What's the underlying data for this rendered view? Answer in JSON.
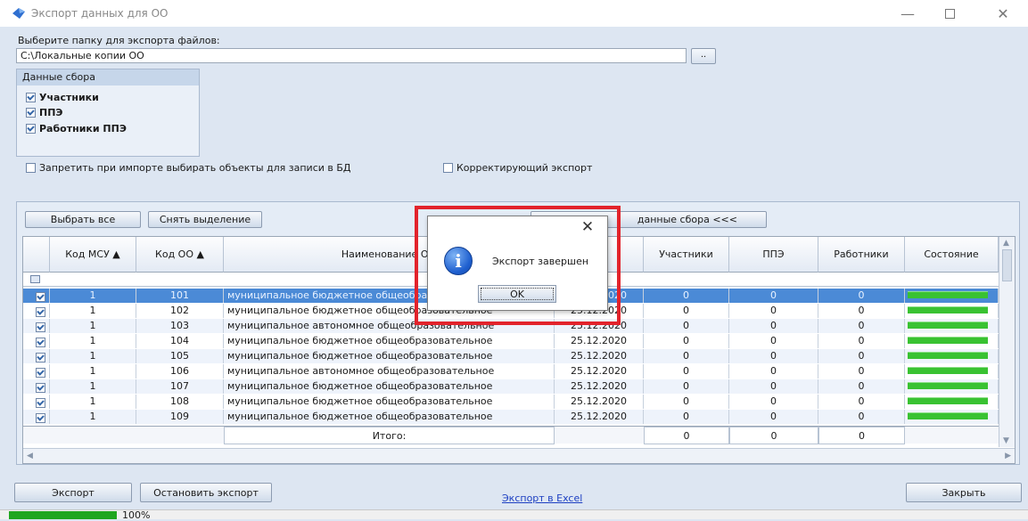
{
  "window": {
    "title": "Экспорт данных для ОО",
    "brand_color": "#1e5fcf"
  },
  "form": {
    "folder_label": "Выберите папку для экспорта файлов:",
    "folder_value": "C:\\Локальные копии ОО",
    "browse_label": "..",
    "group_title": "Данные сбора",
    "checkboxes": [
      {
        "label": "Участники",
        "checked": true
      },
      {
        "label": "ППЭ",
        "checked": true
      },
      {
        "label": "Работники ППЭ",
        "checked": true
      }
    ],
    "option_forbid": "Запретить при импорте выбирать объекты для записи в БД",
    "option_correcting": "Корректирующий экспорт"
  },
  "toolbar": {
    "select_all": "Выбрать все",
    "deselect": "Снять выделение",
    "show_data": "данные сбора <<<"
  },
  "grid": {
    "headers": {
      "msu": "Код МСУ ▲",
      "oo": "Код ОО ▲",
      "name": "Наименование ОО",
      "participants": "Участники",
      "ppe": "ППЭ",
      "workers": "Работники",
      "state": "Состояние"
    },
    "rows": [
      {
        "msu": "1",
        "oo": "101",
        "name": "муниципальное бюджетное общеобразовательное",
        "date": "25.12.2020",
        "participants": "0",
        "ppe": "0",
        "workers": "0",
        "progress": 1.0,
        "selected": true
      },
      {
        "msu": "1",
        "oo": "102",
        "name": "муниципальное бюджетное общеобразовательное",
        "date": "25.12.2020",
        "participants": "0",
        "ppe": "0",
        "workers": "0",
        "progress": 1.0,
        "selected": false
      },
      {
        "msu": "1",
        "oo": "103",
        "name": "муниципальное автономное общеобразовательное",
        "date": "25.12.2020",
        "participants": "0",
        "ppe": "0",
        "workers": "0",
        "progress": 1.0,
        "selected": false
      },
      {
        "msu": "1",
        "oo": "104",
        "name": "муниципальное бюджетное общеобразовательное",
        "date": "25.12.2020",
        "participants": "0",
        "ppe": "0",
        "workers": "0",
        "progress": 1.0,
        "selected": false
      },
      {
        "msu": "1",
        "oo": "105",
        "name": "муниципальное бюджетное общеобразовательное",
        "date": "25.12.2020",
        "participants": "0",
        "ppe": "0",
        "workers": "0",
        "progress": 1.0,
        "selected": false
      },
      {
        "msu": "1",
        "oo": "106",
        "name": "муниципальное автономное общеобразовательное",
        "date": "25.12.2020",
        "participants": "0",
        "ppe": "0",
        "workers": "0",
        "progress": 1.0,
        "selected": false
      },
      {
        "msu": "1",
        "oo": "107",
        "name": "муниципальное бюджетное общеобразовательное",
        "date": "25.12.2020",
        "participants": "0",
        "ppe": "0",
        "workers": "0",
        "progress": 1.0,
        "selected": false
      },
      {
        "msu": "1",
        "oo": "108",
        "name": "муниципальное бюджетное общеобразовательное",
        "date": "25.12.2020",
        "participants": "0",
        "ppe": "0",
        "workers": "0",
        "progress": 1.0,
        "selected": false
      },
      {
        "msu": "1",
        "oo": "109",
        "name": "муниципальное бюджетное общеобразовательное",
        "date": "25.12.2020",
        "participants": "0",
        "ppe": "0",
        "workers": "0",
        "progress": 1.0,
        "selected": false
      }
    ],
    "total_label": "Итого:",
    "totals": {
      "participants": "0",
      "ppe": "0",
      "workers": "0"
    }
  },
  "footer": {
    "export": "Экспорт",
    "stop_export": "Остановить экспорт",
    "excel_link": "Экспорт в Excel",
    "close": "Закрыть",
    "progress_text": "100%",
    "progress_value": 1.0
  },
  "dialog": {
    "close_glyph": "✕",
    "icon": "info-icon",
    "message": "Экспорт завершен",
    "ok": "OK",
    "highlight_color": "#e2232b"
  }
}
